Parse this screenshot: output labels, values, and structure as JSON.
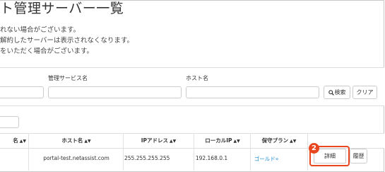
{
  "page": {
    "title": "ト管理サーバー一覧",
    "notes": [
      "れない場合がございます。",
      "解約したサーバーは表示されなくなります。",
      "をいただく場合がございます。"
    ]
  },
  "search": {
    "service_label": "管理サービス名",
    "host_label": "ホスト名",
    "search_button": "検索",
    "clear_button": "クリア"
  },
  "table": {
    "headers": {
      "name": "名",
      "host": "ホスト名",
      "ip": "IPアドレス",
      "local_ip": "ローカルIP",
      "plan": "保守プラン"
    },
    "row": {
      "host": "portal-test.netassist.com",
      "ip": "255.255.255.255",
      "local_ip": "192.168.0.1",
      "plan": "ゴールド»",
      "detail_button": "詳細",
      "history_button": "履歴"
    }
  },
  "annotation": {
    "badge": "2",
    "color": "#e8471f"
  }
}
